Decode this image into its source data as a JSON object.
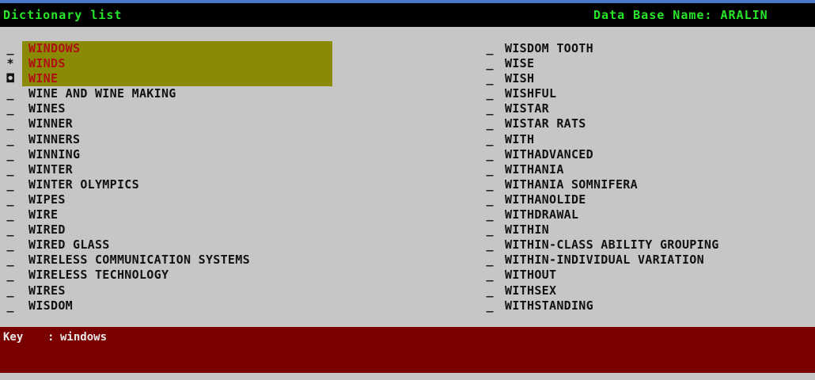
{
  "header": {
    "title": "Dictionary list",
    "database": "Data Base Name: ARALIN"
  },
  "left_column": [
    {
      "marker": "_",
      "term": "WINDOWS"
    },
    {
      "marker": "*",
      "term": "WINDS"
    },
    {
      "marker": "◘",
      "term": "WINE"
    },
    {
      "marker": "_",
      "term": "WINE AND WINE MAKING"
    },
    {
      "marker": "_",
      "term": "WINES"
    },
    {
      "marker": "_",
      "term": "WINNER"
    },
    {
      "marker": "_",
      "term": "WINNERS"
    },
    {
      "marker": "_",
      "term": "WINNING"
    },
    {
      "marker": "_",
      "term": "WINTER"
    },
    {
      "marker": "_",
      "term": "WINTER OLYMPICS"
    },
    {
      "marker": "_",
      "term": "WIPES"
    },
    {
      "marker": "_",
      "term": "WIRE"
    },
    {
      "marker": "_",
      "term": "WIRED"
    },
    {
      "marker": "_",
      "term": "WIRED GLASS"
    },
    {
      "marker": "_",
      "term": "WIRELESS COMMUNICATION SYSTEMS"
    },
    {
      "marker": "_",
      "term": "WIRELESS TECHNOLOGY"
    },
    {
      "marker": "_",
      "term": "WIRES"
    },
    {
      "marker": "_",
      "term": "WISDOM"
    }
  ],
  "right_column": [
    {
      "marker": "_",
      "term": "WISDOM TOOTH"
    },
    {
      "marker": "_",
      "term": "WISE"
    },
    {
      "marker": "_",
      "term": "WISH"
    },
    {
      "marker": "_",
      "term": "WISHFUL"
    },
    {
      "marker": "_",
      "term": "WISTAR"
    },
    {
      "marker": "_",
      "term": "WISTAR RATS"
    },
    {
      "marker": "_",
      "term": "WITH"
    },
    {
      "marker": "_",
      "term": "WITHADVANCED"
    },
    {
      "marker": "_",
      "term": "WITHANIA"
    },
    {
      "marker": "_",
      "term": "WITHANIA SOMNIFERA"
    },
    {
      "marker": "_",
      "term": "WITHANOLIDE"
    },
    {
      "marker": "_",
      "term": "WITHDRAWAL"
    },
    {
      "marker": "_",
      "term": "WITHIN"
    },
    {
      "marker": "_",
      "term": "WITHIN-CLASS ABILITY GROUPING"
    },
    {
      "marker": "_",
      "term": "WITHIN-INDIVIDUAL VARIATION"
    },
    {
      "marker": "_",
      "term": "WITHOUT"
    },
    {
      "marker": "_",
      "term": "WITHSEX"
    },
    {
      "marker": "_",
      "term": "WITHSTANDING"
    }
  ],
  "keybar": {
    "label": "Key",
    "separator": ":",
    "value": "windows"
  },
  "colors": {
    "header_bg": "#000000",
    "header_text": "#27e627",
    "body_bg": "#c6c6c6",
    "highlight_bg": "#8a8a06",
    "highlight_text": "#b01010",
    "keybar_bg": "#7a0000"
  }
}
